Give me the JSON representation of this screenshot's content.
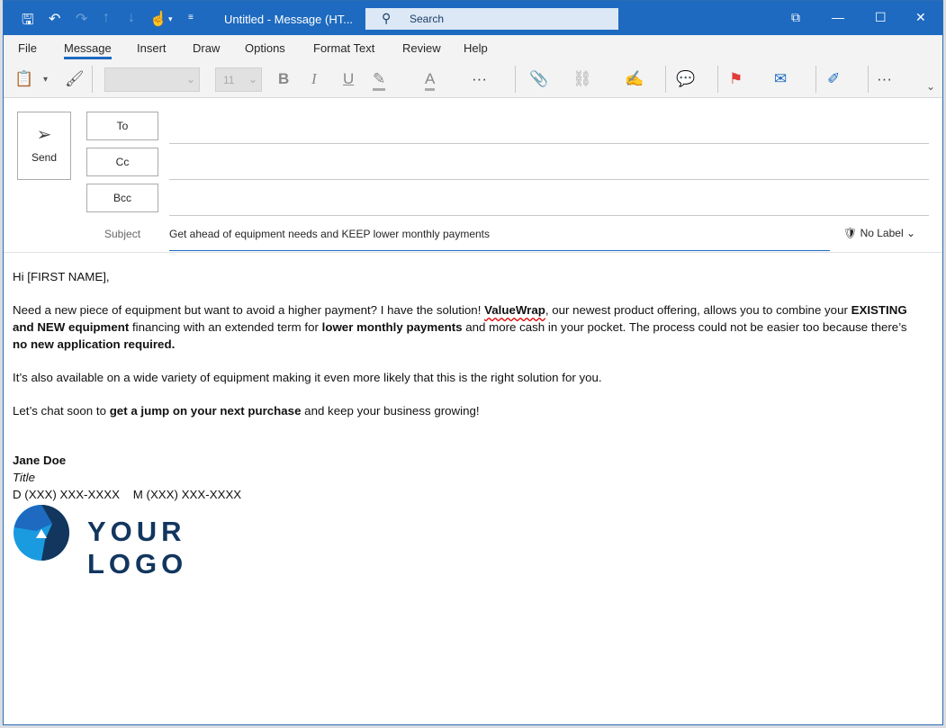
{
  "titlebar": {
    "title": "Untitled - Message (HT...",
    "search_placeholder": "Search"
  },
  "tabs": [
    "File",
    "Message",
    "Insert",
    "Draw",
    "Options",
    "Format Text",
    "Review",
    "Help"
  ],
  "active_tab": "Message",
  "ribbon": {
    "font_size": "11",
    "bold": "B",
    "italic": "I",
    "underline": "U",
    "highlight": "A"
  },
  "compose": {
    "send": "Send",
    "to": "To",
    "cc": "Cc",
    "bcc": "Bcc",
    "subject_label": "Subject",
    "subject": "Get ahead of equipment needs and KEEP lower monthly payments",
    "sensitivity": "No Label"
  },
  "body": {
    "greeting": "Hi [FIRST NAME],",
    "p1a": "Need a new piece of equipment but want to avoid a higher payment? I have the solution! ",
    "p1b": "ValueWrap",
    "p1c": ", our newest product offering, allows you to combine your ",
    "p1d": "EXISTING and NEW equipment",
    "p1e": " financing with an extended term for ",
    "p1f": "lower monthly payments",
    "p1g": " and more cash in your pocket. The process could not be easier too because there’s ",
    "p1h": "no new application required.",
    "p2": "It’s also available on a wide variety of equipment making it even more likely that this is the right solution for you.",
    "p3a": "Let’s chat soon to ",
    "p3b": "get a jump on your next purchase",
    "p3c": " and keep your business growing!",
    "sig_name": "Jane Doe",
    "sig_title": "Title",
    "sig_phone": "D (XXX) XXX-XXXX    M (XXX) XXX-XXXX",
    "logo_text": "YOUR LOGO"
  },
  "colors": {
    "accent": "#1d6ac0",
    "logo_dark": "#12365e",
    "logo_light": "#1a9be0"
  }
}
